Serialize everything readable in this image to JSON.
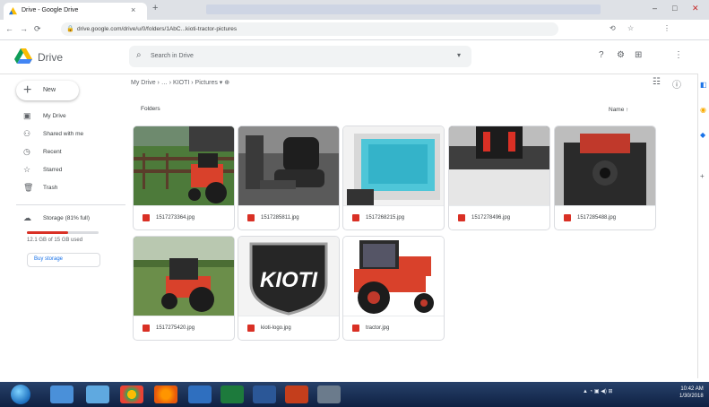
{
  "browser": {
    "tab_title": "Drive - Google Drive",
    "tab_close": "×",
    "new_tab": "+",
    "url": "drive.google.com/drive/u/0/folders/1AbC...kioti-tractor-pictures",
    "window_controls": [
      "–",
      "□",
      "✕"
    ],
    "nav": [
      "←",
      "→",
      "⟳"
    ],
    "right_icons": [
      "⟲",
      "☆",
      "⋮"
    ]
  },
  "drive": {
    "brand": "Drive",
    "search_placeholder": "Search in Drive",
    "header_icons": [
      "?",
      "⚙",
      "⊞",
      "⋮"
    ],
    "new_button": "New",
    "nav": [
      {
        "icon": "▣",
        "label": "My Drive"
      },
      {
        "icon": "⚇",
        "label": "Shared with me"
      },
      {
        "icon": "◷",
        "label": "Recent"
      },
      {
        "icon": "☆",
        "label": "Starred"
      },
      {
        "icon": "🗑",
        "label": "Trash"
      },
      {
        "icon": "☁",
        "label": "Storage (81% full)"
      }
    ],
    "storage_text": "12.1 GB of 15 GB used",
    "buy_storage": "Buy storage",
    "breadcrumb": "My Drive  ›  …  ›  KIOTI  ›  Pictures  ▾  ⊕",
    "section_title": "Folders",
    "sort_label": "Name  ↑",
    "view_icons": [
      "☷",
      "ⓘ"
    ],
    "files": [
      {
        "name": "1517273364.jpg",
        "scene": "fence"
      },
      {
        "name": "1517285811.jpg",
        "scene": "seat"
      },
      {
        "name": "1517268215.jpg",
        "scene": "cooler"
      },
      {
        "name": "1517278496.jpg",
        "scene": "dash"
      },
      {
        "name": "1517285488.jpg",
        "scene": "engine"
      },
      {
        "name": "1517275420.jpg",
        "scene": "tractor-field"
      },
      {
        "name": "kioti-logo.jpg",
        "scene": "logo"
      },
      {
        "name": "tractor.jpg",
        "scene": "tractor"
      }
    ],
    "logo_text": "KIOTI",
    "rail_icons": [
      "◧",
      "◉",
      "◆",
      "+"
    ]
  },
  "taskbar": {
    "tray": "▲ ◔ ▣ ◀) ⊞",
    "clock_time": "10:42 AM",
    "clock_date": "1/30/2018"
  },
  "colors": {
    "accent": "#1a73e8",
    "danger": "#d93025",
    "tractor_red": "#d9412b"
  }
}
